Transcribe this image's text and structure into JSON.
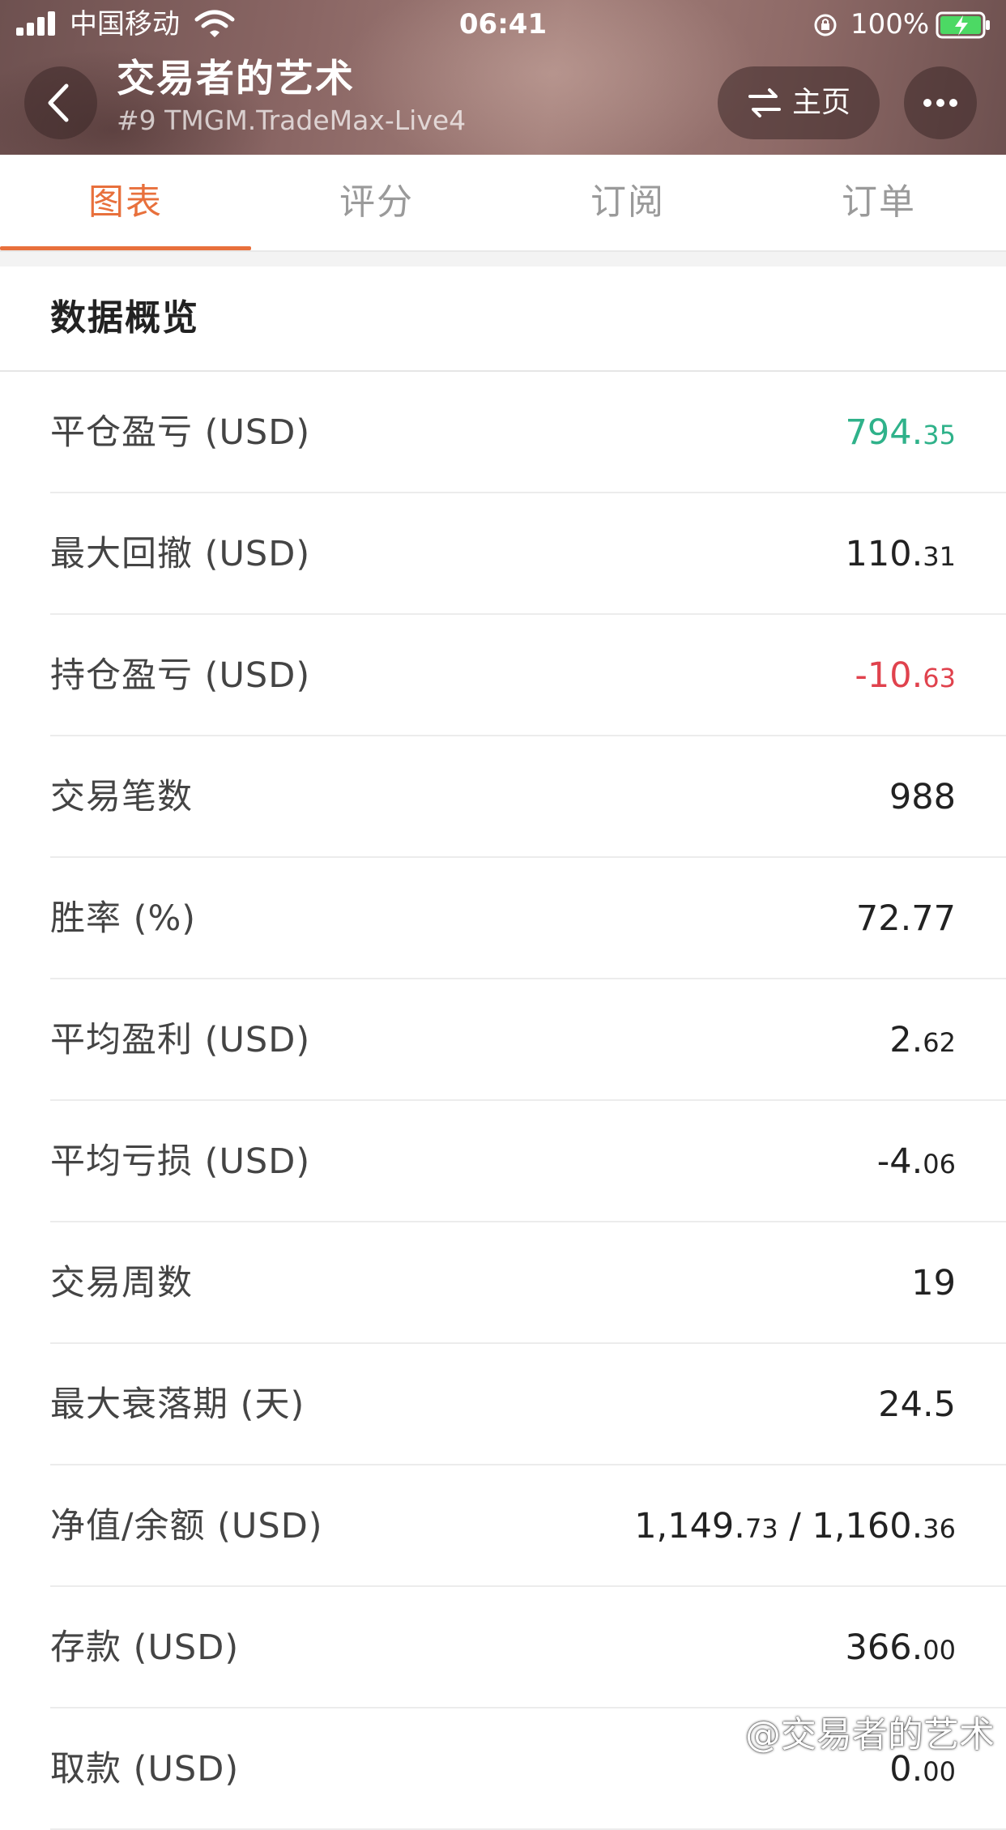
{
  "status_bar": {
    "carrier": "中国移动",
    "time": "06:41",
    "battery_percent": "100%",
    "icons": [
      "signal-icon",
      "wifi-icon",
      "rotation-lock-icon",
      "battery-charging-icon"
    ]
  },
  "nav": {
    "title": "交易者的艺术",
    "subtitle": "#9 TMGM.TradeMax-Live4",
    "home_label": "主页",
    "icons": [
      "back-icon",
      "swap-icon",
      "more-icon"
    ]
  },
  "tabs": [
    {
      "label": "图表",
      "active": true
    },
    {
      "label": "评分",
      "active": false
    },
    {
      "label": "订阅",
      "active": false
    },
    {
      "label": "订单",
      "active": false
    }
  ],
  "section": {
    "title": "数据概览"
  },
  "rows": [
    {
      "label": "平仓盈亏 (USD)",
      "int": "794.",
      "dec": "35"
    },
    {
      "label": "最大回撤 (USD)",
      "int": "110.",
      "dec": "31"
    },
    {
      "label": "持仓盈亏 (USD)",
      "int": "-10.",
      "dec": "63"
    },
    {
      "label": "交易笔数",
      "int": "988",
      "dec": ""
    },
    {
      "label": "胜率 (%)",
      "int": "72.77",
      "dec": ""
    },
    {
      "label": "平均盈利 (USD)",
      "int": "2.",
      "dec": "62"
    },
    {
      "label": "平均亏损 (USD)",
      "int": "-4.",
      "dec": "06"
    },
    {
      "label": "交易周数",
      "int": "19",
      "dec": ""
    },
    {
      "label": "最大衰落期 (天)",
      "int": "24.5",
      "dec": ""
    },
    {
      "label": "净值/余额 (USD)",
      "int": "1,149.",
      "dec": "73",
      "int2": " / 1,160.",
      "dec2": "36"
    },
    {
      "label": "存款 (USD)",
      "int": "366.",
      "dec": "00"
    },
    {
      "label": "取款 (USD)",
      "int": "0.",
      "dec": "00"
    }
  ],
  "colors": {
    "accent": "#e8703c",
    "positive": "#2fb28a",
    "negative": "#e0424d"
  },
  "watermark": "@交易者的艺术"
}
